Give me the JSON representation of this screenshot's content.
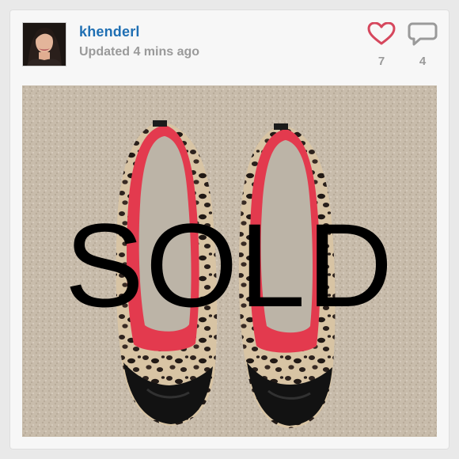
{
  "post": {
    "username": "khenderl",
    "updated": "Updated 4 mins ago",
    "likes": "7",
    "comments": "4",
    "overlay_text": "SOLD",
    "avatar_icon": "user-photo",
    "like_icon": "heart-icon",
    "comment_icon": "speech-bubble-icon",
    "colors": {
      "username": "#1f6fb3",
      "like_icon": "#d6475d",
      "comment_icon": "#9a9a9a",
      "meta_text": "#9a9a9a",
      "photo_background": "#c7bba9",
      "shoe_trim": "#e33a4e",
      "shoe_toe": "#141414"
    }
  }
}
